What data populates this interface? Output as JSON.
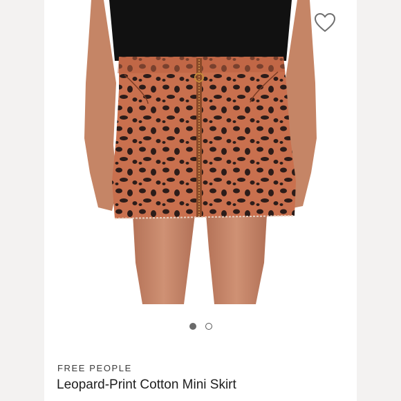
{
  "product": {
    "brand": "FREE PEOPLE",
    "title": "Leopard-Print Cotton Mini Skirt"
  },
  "carousel": {
    "image_count": 2,
    "active_index": 0
  },
  "icons": {
    "favorite": "heart-outline-icon"
  },
  "colors": {
    "skirt": "#c9704e",
    "spots": "#2c1c19",
    "top": "#111111",
    "skin": "#c98a6e",
    "side_band": "#f3f2f1"
  }
}
